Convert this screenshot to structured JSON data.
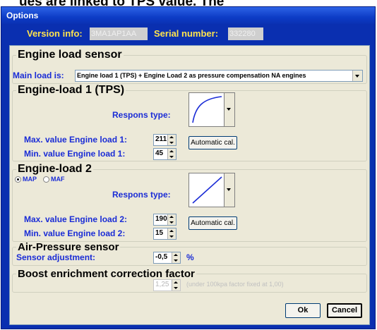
{
  "background_text": "ues are linked to TPS value. The",
  "window": {
    "title": "Options"
  },
  "version": {
    "label": "Version info:",
    "value": "3MA1AP1AA",
    "serial_label": "Serial number:",
    "serial_value": "332280"
  },
  "engine_load_sensor": {
    "title": "Engine load sensor",
    "main_load_label": "Main load is:",
    "main_load_value": "Engine load 1 (TPS) + Engine Load 2 as pressure compensation NA engines"
  },
  "engine_load_1": {
    "title": "Engine-load 1 (TPS)",
    "respons_label": "Respons type:",
    "respons_curve_icon": "log-curve-icon",
    "max_label": "Max. value Engine load 1:",
    "max_value": "211",
    "min_label": "Min.  value Engine load 1:",
    "min_value": "45",
    "auto_cal_label": "Automatic cal."
  },
  "engine_load_2": {
    "title": "Engine-load 2",
    "radio_map": "MAP",
    "radio_maf": "MAF",
    "selected": "MAP",
    "respons_label": "Respons type:",
    "respons_curve_icon": "linear-curve-icon",
    "max_label": "Max. value Engine load 2:",
    "max_value": "190",
    "min_label": "Min.  value Engine load 2:",
    "min_value": "15",
    "auto_cal_label": "Automatic cal."
  },
  "air_pressure": {
    "title": "Air-Pressure sensor",
    "adjust_label": "Sensor adjustment:",
    "adjust_value": "-0,5",
    "unit": "%"
  },
  "boost": {
    "title": "Boost enrichment correction factor",
    "value": "1,25",
    "note": "(under 100kpa factor fixed at 1,00)"
  },
  "buttons": {
    "ok": "Ok",
    "cancel": "Cancel"
  },
  "colors": {
    "titlebar": "#0d3cc6",
    "label_blue": "#1a2cd6",
    "version_yellow": "#ffe34d",
    "panel": "#ece9d8"
  }
}
